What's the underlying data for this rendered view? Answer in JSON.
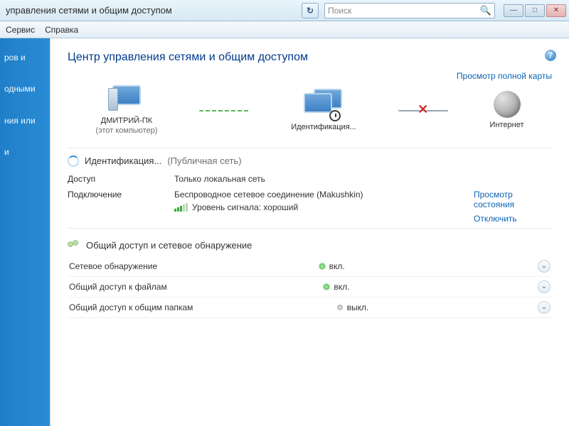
{
  "window": {
    "title": "управления сетями и общим доступом",
    "search_placeholder": "Поиск"
  },
  "menubar": {
    "service": "Сервис",
    "help": "Справка"
  },
  "sidebar": {
    "item1": "ров и",
    "item2": "одными",
    "item3": "ния или",
    "item4": "и"
  },
  "page": {
    "title": "Центр управления сетями и общим доступом",
    "map_link": "Просмотр полной карты"
  },
  "nodes": {
    "pc_label": "ДМИТРИЙ-ПК",
    "pc_sub": "(этот компьютер)",
    "network_label": "Идентификация...",
    "internet_label": "Интернет"
  },
  "status": {
    "identifying": "Идентификация...",
    "net_type": "(Публичная сеть)"
  },
  "details": {
    "access_label": "Доступ",
    "access_value": "Только локальная сеть",
    "conn_label": "Подключение",
    "conn_value": "Беспроводное сетевое соединение (Makushkin)",
    "view_status": "Просмотр состояния",
    "signal_label": "Уровень сигнала: хороший",
    "disconnect": "Отключить"
  },
  "sharing": {
    "heading": "Общий доступ и сетевое обнаружение",
    "rows": [
      {
        "label": "Сетевое обнаружение",
        "state": "вкл.",
        "on": true
      },
      {
        "label": "Общий доступ к файлам",
        "state": "вкл.",
        "on": true
      },
      {
        "label": "Общий доступ к общим папкам",
        "state": "выкл.",
        "on": false
      }
    ]
  }
}
